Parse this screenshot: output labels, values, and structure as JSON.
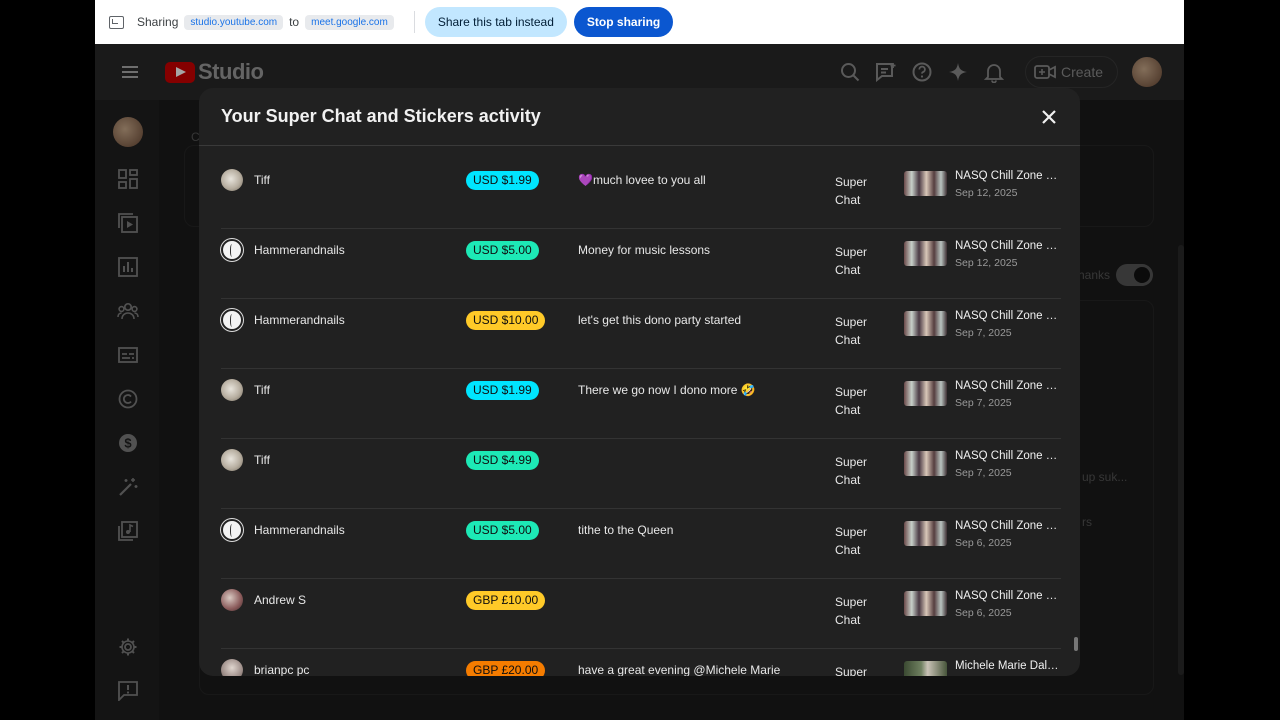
{
  "share_bar": {
    "sharing_label": "Sharing",
    "source": "studio.youtube.com",
    "to_label": "to",
    "target": "meet.google.com",
    "share_tab_button": "Share this tab instead",
    "stop_button": "Stop sharing"
  },
  "header": {
    "logo_text": "Studio",
    "create_label": "Create",
    "icons": [
      "search-icon",
      "comment-icon",
      "help-icon",
      "sparkle-icon",
      "bell-icon",
      "create-video-icon"
    ]
  },
  "sidebar": {
    "icons": [
      "dashboard-icon",
      "content-icon",
      "analytics-icon",
      "community-icon",
      "subtitles-icon",
      "copyright-icon",
      "earn-icon",
      "customization-icon",
      "audio-library-icon",
      "settings-icon",
      "feedback-icon"
    ]
  },
  "background": {
    "partial_left": "C",
    "thanks_label": "hanks",
    "partial_1": "up suk...",
    "partial_2": "rs"
  },
  "modal": {
    "title": "Your Super Chat and Stickers activity",
    "rows": [
      {
        "name": "Tiff",
        "avatar": "tiff",
        "amount": "USD $1.99",
        "color": "#00e5ff",
        "message": "💜much lovee to you all",
        "type_line1": "Super",
        "type_line2": "Chat",
        "video_title": "NASQ Chill Zone fo...",
        "date": "Sep 12, 2025"
      },
      {
        "name": "Hammerandnails",
        "avatar": "hammer",
        "amount": "USD $5.00",
        "color": "#1de9b6",
        "message": "Money for music lessons",
        "type_line1": "Super",
        "type_line2": "Chat",
        "video_title": "NASQ Chill Zone fo...",
        "date": "Sep 12, 2025"
      },
      {
        "name": "Hammerandnails",
        "avatar": "hammer",
        "amount": "USD $10.00",
        "color": "#ffca28",
        "message": "let's get this dono party started",
        "type_line1": "Super",
        "type_line2": "Chat",
        "video_title": "NASQ Chill Zone fo...",
        "date": "Sep 7, 2025"
      },
      {
        "name": "Tiff",
        "avatar": "tiff",
        "amount": "USD $1.99",
        "color": "#00e5ff",
        "message": "There we go now I dono more 🤣",
        "type_line1": "Super",
        "type_line2": "Chat",
        "video_title": "NASQ Chill Zone fo...",
        "date": "Sep 7, 2025"
      },
      {
        "name": "Tiff",
        "avatar": "tiff",
        "amount": "USD $4.99",
        "color": "#1de9b6",
        "message": "",
        "type_line1": "Super",
        "type_line2": "Chat",
        "video_title": "NASQ Chill Zone fo...",
        "date": "Sep 7, 2025"
      },
      {
        "name": "Hammerandnails",
        "avatar": "hammer",
        "amount": "USD $5.00",
        "color": "#1de9b6",
        "message": "tithe to the Queen",
        "type_line1": "Super",
        "type_line2": "Chat",
        "video_title": "NASQ Chill Zone fo...",
        "date": "Sep 6, 2025"
      },
      {
        "name": "Andrew S",
        "avatar": "andrew",
        "amount": "GBP £10.00",
        "color": "#ffca28",
        "message": "",
        "type_line1": "Super",
        "type_line2": "Chat",
        "video_title": "NASQ Chill Zone fo...",
        "date": "Sep 6, 2025"
      },
      {
        "name": "brianpc pc",
        "avatar": "brian",
        "amount": "GBP £20.00",
        "color": "#f57c00",
        "message": "have a great evening @Michele Marie",
        "type_line1": "Super",
        "type_line2": "",
        "video_title": "Michele Marie Dale...",
        "date": ""
      }
    ]
  }
}
